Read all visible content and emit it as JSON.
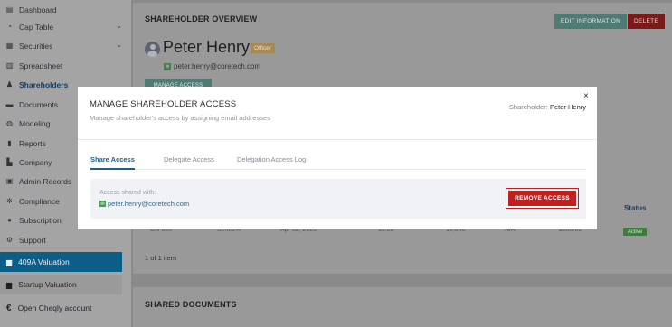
{
  "sidebar": {
    "items": [
      {
        "label": "Dashboard",
        "icon": "dashboard-icon"
      },
      {
        "label": "Cap Table",
        "icon": "pie-chart-icon",
        "has_chevron": true
      },
      {
        "label": "Securities",
        "icon": "document-icon",
        "has_chevron": true
      },
      {
        "label": "Spreadsheet",
        "icon": "spreadsheet-icon"
      },
      {
        "label": "Shareholders",
        "icon": "users-icon",
        "active": true
      },
      {
        "label": "Documents",
        "icon": "folder-icon"
      },
      {
        "label": "Modeling",
        "icon": "modeling-icon"
      },
      {
        "label": "Reports",
        "icon": "reports-icon"
      },
      {
        "label": "Company",
        "icon": "building-icon"
      },
      {
        "label": "Admin Records",
        "icon": "records-icon"
      },
      {
        "label": "Compliance",
        "icon": "shield-icon"
      },
      {
        "label": "Subscription",
        "icon": "dollar-icon"
      },
      {
        "label": "Support",
        "icon": "support-icon"
      }
    ],
    "valuation_409a": "409A Valuation",
    "startup_valuation": "Startup Valuation",
    "open_cheqly": "Open Cheqly account"
  },
  "overview": {
    "title": "SHAREHOLDER OVERVIEW",
    "edit_label": "EDIT INFORMATION",
    "delete_label": "DELETE",
    "name": "Peter Henry",
    "badge": "Officer",
    "email": "peter.henry@coretech.com",
    "manage_access_label": "MANAGE ACCESS"
  },
  "table": {
    "status_header": "Status",
    "row": {
      "c1": "CN-000",
      "c2": "Series A",
      "c3": "Apr 02, 2023",
      "c4": "10.00",
      "c5": "10,000",
      "c6": "N/A",
      "c7": "$100.00",
      "status": "Active"
    },
    "pager": "1 of 1 item"
  },
  "shared_documents": {
    "title": "SHARED DOCUMENTS"
  },
  "modal": {
    "title": "MANAGE SHAREHOLDER ACCESS",
    "subtitle": "Manage shareholder's access by assigning email addresses",
    "shareholder_prefix": "Shareholder:",
    "shareholder_name": "Peter Henry",
    "close_glyph": "×",
    "tabs": [
      {
        "label": "Share Access",
        "active": true
      },
      {
        "label": "Delegate Access"
      },
      {
        "label": "Delegation Access Log"
      }
    ],
    "access_label": "Access shared with:",
    "access_email": "peter.henry@coretech.com",
    "remove_label": "REMOVE ACCESS"
  },
  "colors": {
    "accent_teal": "#4e7b74",
    "danger_red": "#c21f1f",
    "active_blue": "#1d5f87",
    "sidebar_highlight": "#0d5e86"
  }
}
